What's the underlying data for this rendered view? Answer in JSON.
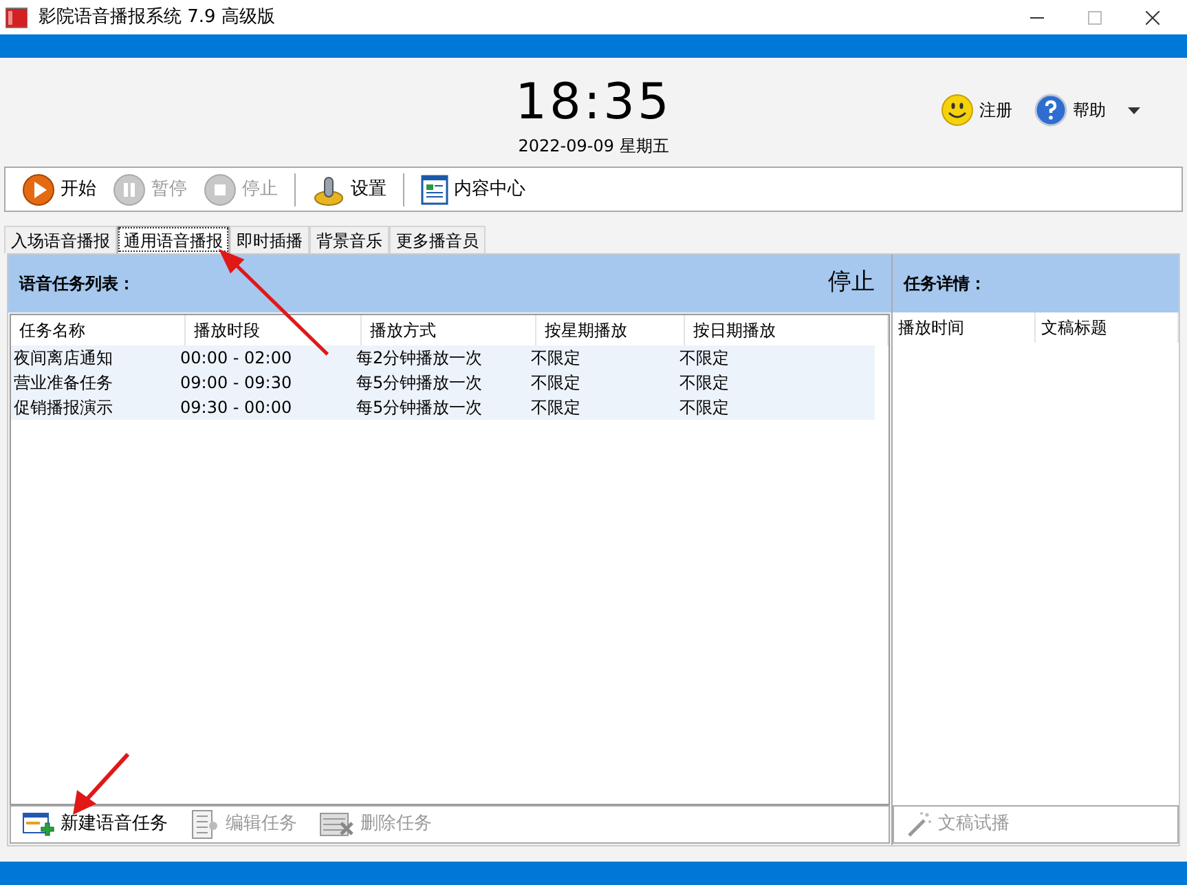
{
  "window": {
    "title": "影院语音播报系统 7.9 高级版"
  },
  "clock": {
    "time": "18:35",
    "date": "2022-09-09 星期五"
  },
  "header_links": [
    {
      "label": "注册",
      "kind": "smiley"
    },
    {
      "label": "帮助",
      "kind": "help"
    }
  ],
  "toolbar": [
    {
      "label": "开始",
      "kind": "play",
      "disabled": false
    },
    {
      "label": "暂停",
      "kind": "pause",
      "disabled": true
    },
    {
      "label": "停止",
      "kind": "stop",
      "disabled": true
    },
    {
      "label": "设置",
      "kind": "settings",
      "disabled": false
    },
    {
      "label": "内容中心",
      "kind": "document",
      "disabled": false
    }
  ],
  "tabs": [
    {
      "label": "入场语音播报",
      "selected": false
    },
    {
      "label": "通用语音播报",
      "selected": true
    },
    {
      "label": "即时插播",
      "selected": false
    },
    {
      "label": "背景音乐",
      "selected": false
    },
    {
      "label": "更多播音员",
      "selected": false
    }
  ],
  "task_list": {
    "title": "语音任务列表：",
    "status": "停止",
    "columns": [
      "任务名称",
      "播放时段",
      "播放方式",
      "按星期播放",
      "按日期播放"
    ],
    "rows": [
      [
        "夜间离店通知",
        "00:00 - 02:00",
        "每2分钟播放一次",
        "不限定",
        "不限定"
      ],
      [
        "营业准备任务",
        "09:00 - 09:30",
        "每5分钟播放一次",
        "不限定",
        "不限定"
      ],
      [
        "促销播报演示",
        "09:30 - 00:00",
        "每5分钟播放一次",
        "不限定",
        "不限定"
      ]
    ],
    "actions": [
      {
        "label": "新建语音任务",
        "kind": "new",
        "disabled": false
      },
      {
        "label": "编辑任务",
        "kind": "edit",
        "disabled": true
      },
      {
        "label": "删除任务",
        "kind": "delete",
        "disabled": true
      }
    ]
  },
  "task_detail": {
    "title": "任务详情：",
    "columns": [
      "播放时间",
      "文稿标题"
    ],
    "actions": [
      {
        "label": "文稿试播",
        "kind": "wand",
        "disabled": true
      }
    ]
  }
}
